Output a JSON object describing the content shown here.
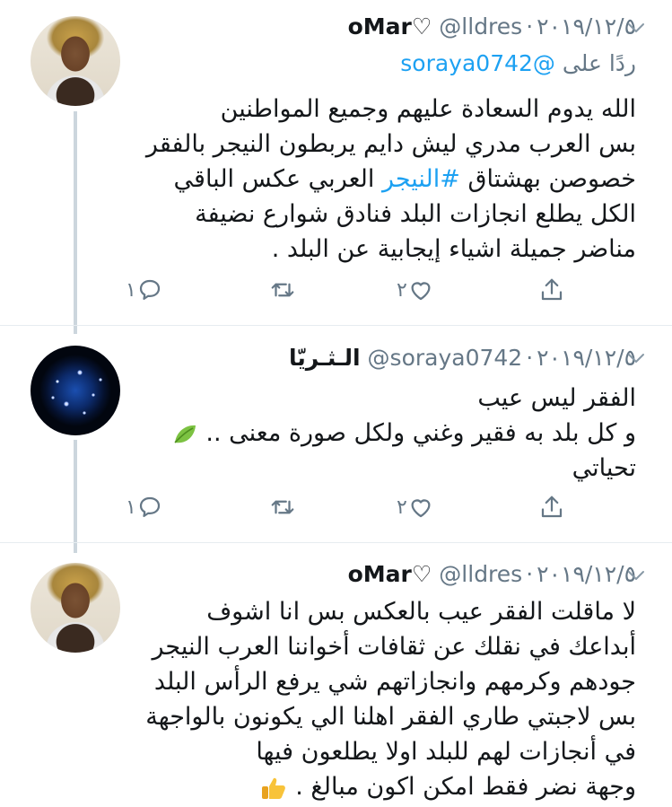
{
  "tweets": [
    {
      "name": "oMar♡",
      "handle": "@lldres",
      "date": "٢٠١٩/١٢/٥",
      "reply_label": "ردًا على",
      "reply_to": "@soraya0742",
      "lines": [
        "الله يدوم السعادة عليهم وجميع المواطنين",
        "بس العرب مدري ليش دايم يربطون النيجر بالفقر",
        "خصوصن بهشتاق",
        "#النيجر",
        "العربي عكس الباقي",
        "الكل يطلع انجازات البلد فنادق شوارع نضيفة",
        "مناضر جميلة اشياء إيجابية عن البلد ."
      ],
      "reply_count": "١",
      "retweet_count": "",
      "like_count": "٢"
    },
    {
      "name": "الـثـريّا",
      "handle": "@soraya0742",
      "date": "٢٠١٩/١٢/٥",
      "lines": [
        "الفقر ليس عيب",
        "و كل بلد به فقير وغني ولكل صورة معنى ..",
        "تحياتي"
      ],
      "reply_count": "١",
      "retweet_count": "",
      "like_count": "٢"
    },
    {
      "name": "oMar♡",
      "handle": "@lldres",
      "date": "٢٠١٩/١٢/٥",
      "lines": [
        "لا ماقلت الفقر عيب بالعكس بس انا اشوف",
        "أبداعك في نقلك عن ثقافات أخواننا العرب النيجر",
        "جودهم وكرمهم وانجازاتهم شي يرفع الرأس البلد",
        "بس لاجبتي طاري الفقر اهلنا الي يكونون بالواجهة",
        "في أنجازات لهم للبلد اولا يطلعون فيها",
        "وجهة نضر فقط امكن اكون مبالغ ."
      ]
    }
  ],
  "icons": {
    "reply": "reply-icon",
    "retweet": "retweet-icon",
    "like": "heart-icon",
    "share": "share-icon",
    "more": "chevron-down-icon",
    "leaf": "leaf-emoji",
    "thumb": "thumbs-up-emoji"
  },
  "colors": {
    "accent": "#1da1f2",
    "muted": "#657786",
    "text": "#14171a",
    "divider": "#e6ecf0",
    "thread_line": "#ccd6dd"
  }
}
